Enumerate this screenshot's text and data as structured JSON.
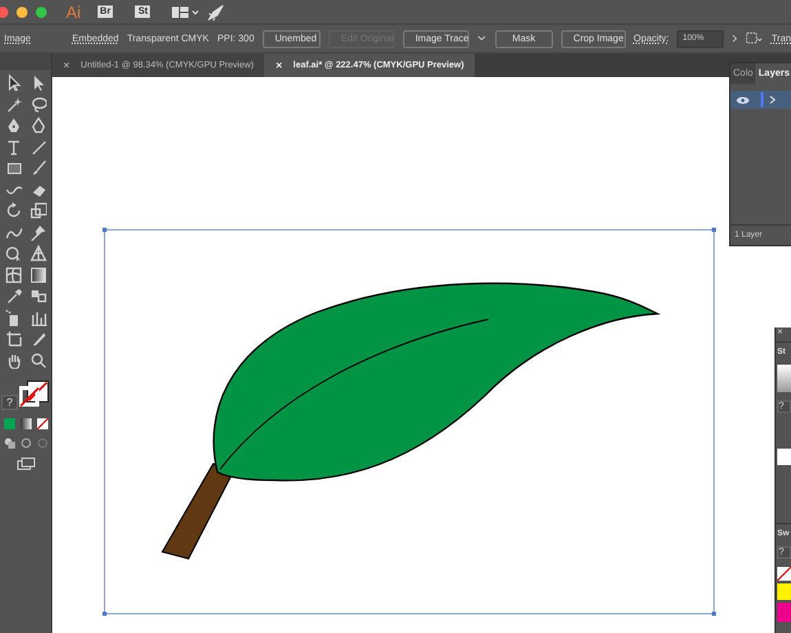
{
  "app_bar": {
    "logo": "Ai",
    "bridge": "Br",
    "stock": "St"
  },
  "control_bar": {
    "object_type": "Image",
    "link": "Embedded",
    "color_mode": "Transparent CMYK",
    "ppi": "PPI: 300",
    "buttons": [
      {
        "label": "Unembed",
        "disabled": false
      },
      {
        "label": "Edit Original",
        "disabled": true
      },
      {
        "label": "Image Trace",
        "disabled": false,
        "dropdown": true
      },
      {
        "label": "Mask",
        "disabled": false
      },
      {
        "label": "Crop Image",
        "disabled": false
      }
    ],
    "opacity_label": "Opacity:",
    "opacity_value": "100%",
    "transform": "Tran"
  },
  "tabs": [
    {
      "close": "×",
      "label": "Untitled-1 @ 98.34% (CMYK/GPU Preview)",
      "selected": false
    },
    {
      "close": "×",
      "label": "leaf.ai* @ 222.47% (CMYK/GPU Preview)",
      "selected": true
    }
  ],
  "toolbar": {
    "help": "?"
  },
  "layers_panel": {
    "tabs": [
      {
        "label": "Colo",
        "selected": false
      },
      {
        "label": "Layers",
        "selected": true
      }
    ],
    "layers": [
      {
        "visible": true,
        "selected": true
      }
    ],
    "footer": "1 Layer"
  },
  "side_panel": {
    "close": "×",
    "sections": [
      {
        "title": "St",
        "help": "?"
      },
      {
        "title": "Sw",
        "help": "?"
      }
    ]
  }
}
